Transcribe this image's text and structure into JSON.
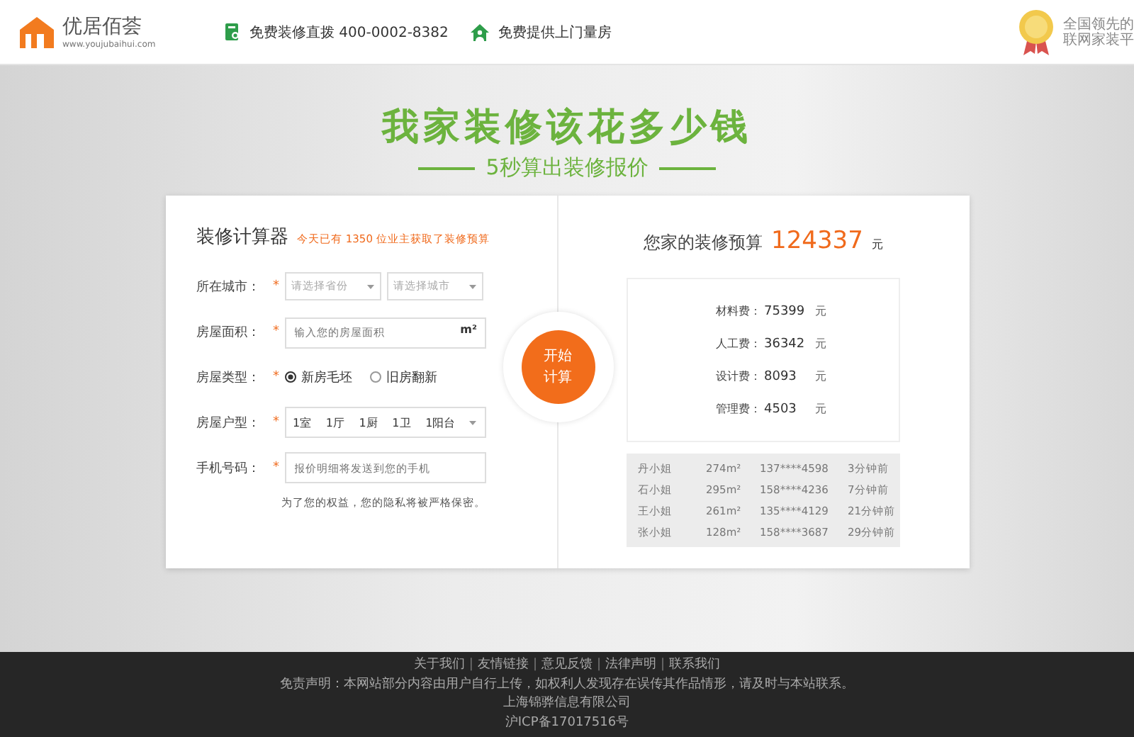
{
  "header": {
    "logo": {
      "name": "优居佰荟",
      "url": "www.youjubaihui.com"
    },
    "items": [
      {
        "kind": "phone",
        "text": "免费装修直拨 400-0002-8382"
      },
      {
        "kind": "house",
        "text": "免费提供上门量房"
      }
    ],
    "badge_lines": [
      "全国领先的",
      "联网家装平"
    ]
  },
  "hero": {
    "title": "我家装修该花多少钱",
    "subtitle": "5秒算出装修报价"
  },
  "calculator": {
    "title": "装修计算器",
    "notice": {
      "prefix": "今天已有",
      "count": "1350",
      "suffix": "位业主获取了装修预算"
    },
    "fields": [
      {
        "kind": "select-pair",
        "label": "所在城市：",
        "mark": "*",
        "placeholders": [
          "请选择省份",
          "请选择城市"
        ]
      },
      {
        "kind": "input-unit",
        "label": "房屋面积：",
        "mark": "*",
        "placeholder": "输入您的房屋面积",
        "unit": "m²"
      },
      {
        "kind": "radio",
        "label": "房屋类型：",
        "mark": "*",
        "options": [
          {
            "text": "新房毛坯",
            "selected": true
          },
          {
            "text": "旧房翻新",
            "selected": false
          }
        ]
      },
      {
        "kind": "layout",
        "label": "房屋户型：",
        "mark": "*",
        "values": [
          "1室",
          "1厅",
          "1厨",
          "1卫",
          "1阳台"
        ]
      },
      {
        "kind": "input",
        "label": "手机号码：",
        "mark": "*",
        "placeholder": "报价明细将发送到您的手机"
      }
    ],
    "privacy": "为了您的权益，您的隐私将被严格保密。",
    "button": [
      "开始",
      "计算"
    ]
  },
  "budget": {
    "label": "您家的装修预算",
    "amount": "124337",
    "unit": "元",
    "items": [
      {
        "label": "材料费：",
        "value": "75399",
        "unit": "元"
      },
      {
        "label": "人工费：",
        "value": "36342",
        "unit": "元"
      },
      {
        "label": "设计费：",
        "value": "8093",
        "unit": "元"
      },
      {
        "label": "管理费：",
        "value": "4503",
        "unit": "元"
      }
    ],
    "recent": [
      [
        "丹小姐",
        "274m²",
        "137****4598",
        "3分钟前"
      ],
      [
        "石小姐",
        "295m²",
        "158****4236",
        "7分钟前"
      ],
      [
        "王小姐",
        "261m²",
        "135****4129",
        "21分钟前"
      ],
      [
        "张小姐",
        "128m²",
        "158****3687",
        "29分钟前"
      ]
    ]
  },
  "footer": {
    "links": [
      "关于我们",
      "友情链接",
      "意见反馈",
      "法律声明",
      "联系我们"
    ],
    "separators": [
      "|",
      "|",
      "|",
      "|"
    ],
    "disclaimer": "免责声明：本网站部分内容由用户自行上传，如权利人发现存在误传其作品情形，请及时与本站联系。",
    "company": "上海锦骅信息有限公司",
    "icp": "沪ICP备17017516号"
  }
}
